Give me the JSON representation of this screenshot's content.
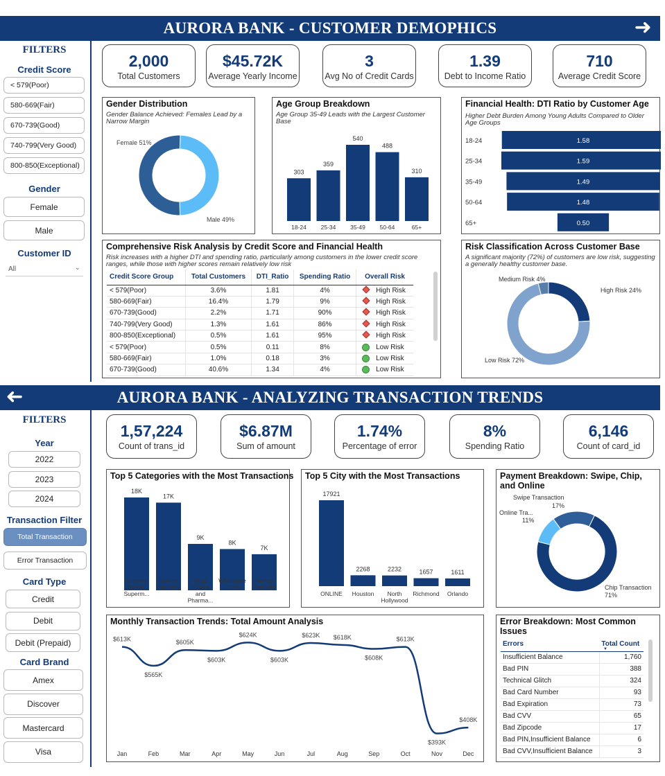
{
  "top": {
    "title": "AURORA BANK - CUSTOMER DEMOPHICS",
    "filters_label": "FILTERS",
    "credit_score_label": "Credit Score",
    "credit_scores": [
      "< 579(Poor)",
      "580-669(Fair)",
      "670-739(Good)",
      "740-799(Very Good)",
      "800-850(Exceptional)"
    ],
    "gender_label": "Gender",
    "genders": [
      "Female",
      "Male"
    ],
    "customer_id_label": "Customer ID",
    "customer_id_value": "All",
    "kpis": [
      {
        "value": "2,000",
        "label": "Total Customers"
      },
      {
        "value": "$45.72K",
        "label": "Average Yearly Income"
      },
      {
        "value": "3",
        "label": "Avg No of Credit Cards"
      },
      {
        "value": "1.39",
        "label": "Debt to Income Ratio"
      },
      {
        "value": "710",
        "label": "Average Credit Score"
      }
    ],
    "gender_chart": {
      "title": "Gender Distribution",
      "subtitle": "Gender Balance Achieved: Females Lead by a Narrow Margin",
      "female_label": "Female 51%",
      "male_label": "Male 49%"
    },
    "age_chart": {
      "title": "Age Group Breakdown",
      "subtitle": "Age Group 35-49 Leads with the Largest Customer Base"
    },
    "dti_chart": {
      "title": "Financial Health: DTI Ratio by Customer Age",
      "subtitle": "Higher Debt Burden Among Young Adults Compared to Older Age Groups"
    },
    "risk_table": {
      "title": "Comprehensive Risk Analysis by Credit Score and Financial Health",
      "subtitle": "Risk increases with a higher DTI and spending ratio, particularly among customers in the lower credit score ranges, while those with higher scores remain relatively low risk",
      "headers": [
        "Credit Score Group",
        "Total Customers",
        "DTI_Ratio",
        "Spending Ratio",
        "Overall Risk"
      ],
      "rows": [
        [
          "< 579(Poor)",
          "3.6%",
          "1.81",
          "4%",
          "High Risk"
        ],
        [
          "580-669(Fair)",
          "16.4%",
          "1.79",
          "9%",
          "High Risk"
        ],
        [
          "670-739(Good)",
          "2.2%",
          "1.71",
          "90%",
          "High Risk"
        ],
        [
          "740-799(Very Good)",
          "1.3%",
          "1.61",
          "86%",
          "High Risk"
        ],
        [
          "800-850(Exceptional)",
          "0.5%",
          "1.61",
          "95%",
          "High Risk"
        ],
        [
          "< 579(Poor)",
          "0.5%",
          "0.11",
          "8%",
          "Low Risk"
        ],
        [
          "580-669(Fair)",
          "1.0%",
          "0.18",
          "3%",
          "Low Risk"
        ],
        [
          "670-739(Good)",
          "40.6%",
          "1.34",
          "4%",
          "Low Risk"
        ]
      ]
    },
    "risk_chart": {
      "title": "Risk Classification Across Customer Base",
      "subtitle": "A significant majority (72%) of customers are low risk, suggesting a generally healthy customer base.",
      "labels": [
        "High Risk 24%",
        "Low Risk 72%",
        "Medium Risk 4%"
      ]
    }
  },
  "bottom": {
    "title": "AURORA BANK - ANALYZING TRANSACTION TRENDS",
    "filters_label": "FILTERS",
    "year_label": "Year",
    "years": [
      "2022",
      "2023",
      "2024"
    ],
    "txn_filter_label": "Transaction Filter",
    "txn_filters": [
      "Total Transaction",
      "Error Transaction"
    ],
    "card_type_label": "Card Type",
    "card_types": [
      "Credit",
      "Debit",
      "Debit (Prepaid)"
    ],
    "card_brand_label": "Card Brand",
    "card_brands": [
      "Amex",
      "Discover",
      "Mastercard",
      "Visa"
    ],
    "kpis": [
      {
        "value": "1,57,224",
        "label": "Count of trans_id"
      },
      {
        "value": "$6.87M",
        "label": "Sum of amount"
      },
      {
        "value": "1.74%",
        "label": "Percentage of error"
      },
      {
        "value": "8%",
        "label": "Spending Ratio"
      },
      {
        "value": "6,146",
        "label": "Count of card_id"
      }
    ],
    "categories_title": "Top 5 Categories with the Most Transactions",
    "city_title": "Top 5 City with the Most Transactions",
    "payment_chart": {
      "title": "Payment Breakdown: Swipe, Chip, and Online",
      "labels": [
        "Swipe Transaction",
        "17%",
        "Online Tra...",
        "11%",
        "Chip Transaction",
        "71%"
      ]
    },
    "monthly_title": "Monthly Transaction Trends: Total Amount Analysis",
    "errors": {
      "title": "Error Breakdown: Most Common Issues",
      "headers": [
        "Errors",
        "Total Count"
      ],
      "rows": [
        [
          "Insufficient Balance",
          "1,760"
        ],
        [
          "Bad PIN",
          "388"
        ],
        [
          "Technical Glitch",
          "324"
        ],
        [
          "Bad Card Number",
          "93"
        ],
        [
          "Bad Expiration",
          "73"
        ],
        [
          "Bad CVV",
          "65"
        ],
        [
          "Bad Zipcode",
          "17"
        ],
        [
          "Bad PIN,Insufficient Balance",
          "6"
        ],
        [
          "Bad CVV,Insufficient Balance",
          "3"
        ]
      ]
    }
  },
  "colors": {
    "navy": "#123b78",
    "mid": "#2d5f96",
    "light": "#5bbcf7",
    "pale": "#7fa3cc",
    "high": "#e05a4f",
    "low": "#5cb85c"
  },
  "chart_data": [
    {
      "type": "pie",
      "title": "Gender Distribution",
      "categories": [
        "Female",
        "Male"
      ],
      "values": [
        51,
        49
      ]
    },
    {
      "type": "bar",
      "title": "Age Group Breakdown",
      "categories": [
        "18-24",
        "25-34",
        "35-49",
        "50-64",
        "65+"
      ],
      "values": [
        303,
        359,
        540,
        488,
        310
      ]
    },
    {
      "type": "bar",
      "title": "Financial Health: DTI Ratio by Customer Age",
      "categories": [
        "18-24",
        "25-34",
        "35-49",
        "50-64",
        "65+"
      ],
      "values": [
        1.58,
        1.59,
        1.49,
        1.48,
        0.5
      ]
    },
    {
      "type": "pie",
      "title": "Risk Classification Across Customer Base",
      "categories": [
        "High Risk",
        "Low Risk",
        "Medium Risk"
      ],
      "values": [
        24,
        72,
        4
      ]
    },
    {
      "type": "bar",
      "title": "Top 5 Categories with the Most Transactions",
      "categories": [
        "Grocery Stores, Superm...",
        "Service Stations",
        "Drug Stores and Pharma...",
        "Wholesale Clubs",
        "Money Transfer"
      ],
      "values": [
        18000,
        17000,
        9000,
        8000,
        7000
      ],
      "value_labels": [
        "18K",
        "17K",
        "9K",
        "8K",
        "7K"
      ]
    },
    {
      "type": "bar",
      "title": "Top 5 City with the Most Transactions",
      "categories": [
        "ONLINE",
        "Houston",
        "North Hollywood",
        "Richmond",
        "Orlando"
      ],
      "values": [
        17921,
        2268,
        2232,
        1657,
        1611
      ]
    },
    {
      "type": "pie",
      "title": "Payment Breakdown: Swipe, Chip, and Online",
      "categories": [
        "Chip Transaction",
        "Online Tra...",
        "Swipe Transaction"
      ],
      "values": [
        71,
        11,
        17
      ]
    },
    {
      "type": "line",
      "title": "Monthly Transaction Trends: Total Amount Analysis",
      "x": [
        "Jan",
        "Feb",
        "Mar",
        "Apr",
        "May",
        "Jun",
        "Jul",
        "Aug",
        "Sep",
        "Oct",
        "Nov",
        "Dec"
      ],
      "values": [
        613,
        565,
        605,
        603,
        624,
        603,
        623,
        618,
        608,
        613,
        393,
        408
      ],
      "value_labels": [
        "$613K",
        "$565K",
        "$605K",
        "$603K",
        "$624K",
        "$603K",
        "$623K",
        "$618K",
        "$608K",
        "$613K",
        "$393K",
        "$408K"
      ]
    }
  ]
}
